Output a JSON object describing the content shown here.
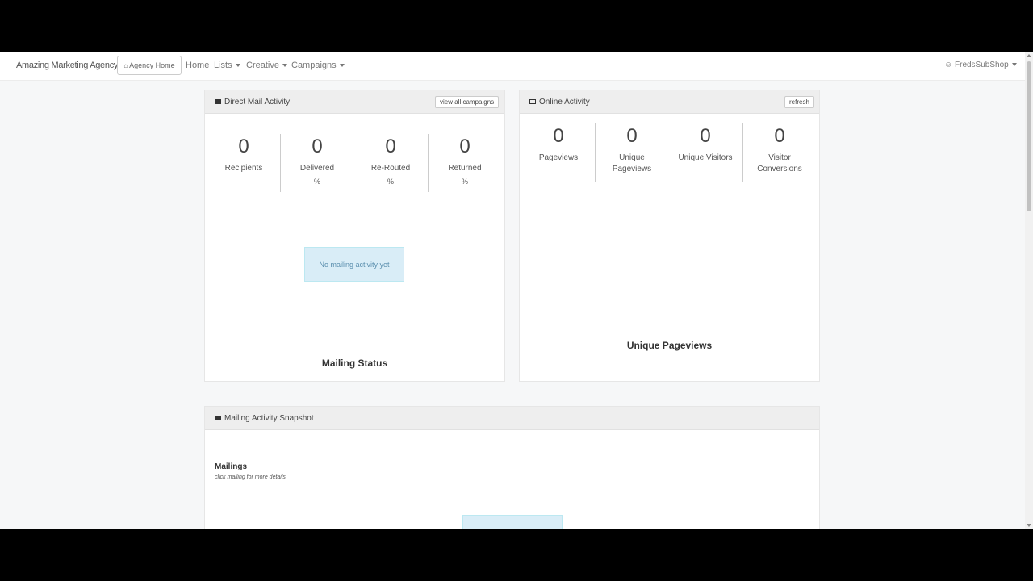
{
  "nav": {
    "brand": "Amazing Marketing Agency",
    "home_button": "Agency Home",
    "items": [
      {
        "label": "Home",
        "dropdown": false
      },
      {
        "label": "Lists",
        "dropdown": true
      },
      {
        "label": "Creative",
        "dropdown": true
      },
      {
        "label": "Campaigns",
        "dropdown": true
      }
    ],
    "user": "FredsSubShop"
  },
  "direct_mail": {
    "title": "Direct Mail Activity",
    "button": "view all campaigns",
    "stats": [
      {
        "value": "0",
        "label": "Recipients",
        "pct": ""
      },
      {
        "value": "0",
        "label": "Delivered",
        "pct": "%"
      },
      {
        "value": "0",
        "label": "Re-Routed",
        "pct": "%"
      },
      {
        "value": "0",
        "label": "Returned",
        "pct": "%"
      }
    ],
    "notice": "No mailing activity yet",
    "chart_title": "Mailing Status"
  },
  "online": {
    "title": "Online Activity",
    "button": "refresh",
    "stats": [
      {
        "value": "0",
        "label": "Pageviews"
      },
      {
        "value": "0",
        "label": "Unique Pageviews"
      },
      {
        "value": "0",
        "label": "Unique Visitors"
      },
      {
        "value": "0",
        "label": "Visitor Conversions"
      }
    ],
    "chart_title": "Unique Pageviews"
  },
  "snapshot": {
    "title": "Mailing Activity Snapshot",
    "section_title": "Mailings",
    "section_sub": "click mailing for more details"
  },
  "colors": {
    "notice_bg": "#d9edf7",
    "header_bg": "#eeeeee"
  }
}
